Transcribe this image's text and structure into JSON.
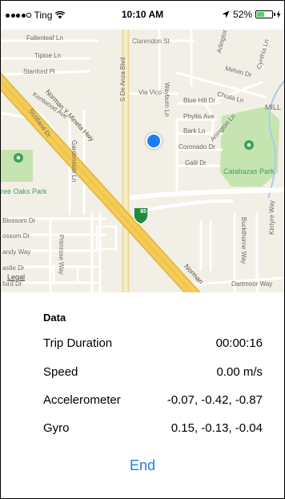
{
  "status_bar": {
    "carrier": "Ting",
    "time": "10:10 AM",
    "battery_percent": "52%",
    "battery_level": 0.52,
    "battery_color": "#4cd964",
    "icons": [
      "signal-dots-icon",
      "wifi-icon",
      "location-arrow-icon",
      "battery-icon",
      "charging-icon"
    ]
  },
  "map": {
    "legal": "Legal",
    "location_dot_color": "#1e7cf2",
    "highway_shield": "85",
    "streets": [
      "Fallenleaf Ln",
      "Tiptoe Ln",
      "Stanford Pl",
      "Clarendon St",
      "S De Anza Blvd",
      "Wayburn Ln",
      "Arlington",
      "Cynthia Ln",
      "Melvin Dr",
      "Via Vico",
      "Chiala Ln",
      "MILL",
      "Kentwood Ave",
      "Norman Y Mineta Hwy",
      "Scotland Dr",
      "Blue Hill Dr",
      "Phyllis Ave",
      "Arlington Ln",
      "Bark Ln",
      "Gardenside Ln",
      "Coronado Dr",
      "Galli Dr",
      "Blossom Dr",
      "ossom Dr",
      "andy Way",
      "astle Dr",
      "ford Dr",
      "Primrose Way",
      "Buckthorne Way",
      "Kintyre Way",
      "Dartmoor Way",
      "Norman"
    ],
    "parks": [
      "ree Oaks Park",
      "Calabazas Park"
    ]
  },
  "data": {
    "title": "Data",
    "rows": [
      {
        "label": "Trip Duration",
        "value": "00:00:16"
      },
      {
        "label": "Speed",
        "value": "0.00 m/s"
      },
      {
        "label": "Accelerometer",
        "value": "-0.07, -0.42, -0.87"
      },
      {
        "label": "Gyro",
        "value": "0.15, -0.13, -0.04"
      }
    ],
    "end_label": "End",
    "accent_color": "#1e7cf2"
  }
}
